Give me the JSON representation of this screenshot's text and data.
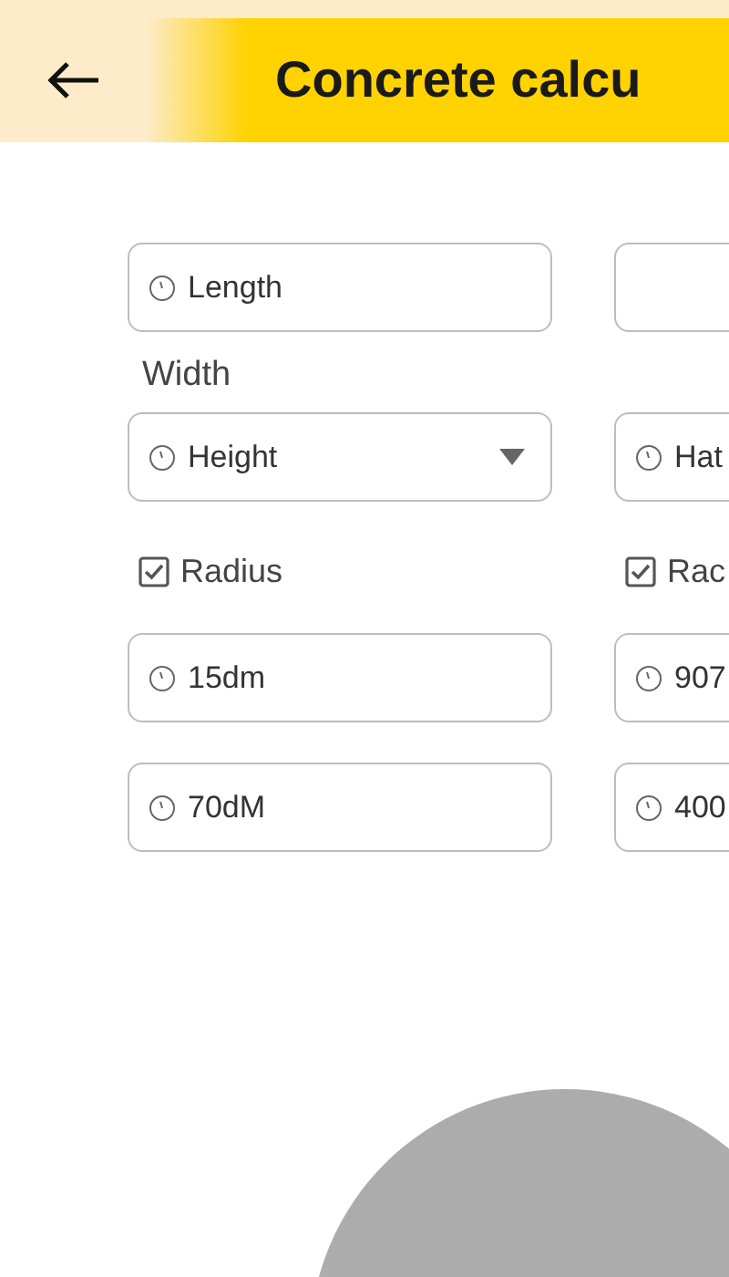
{
  "header": {
    "title": "Concrete calcu"
  },
  "rows": [
    {
      "kind": "fields",
      "cells": [
        {
          "kind": "field",
          "value": "Length"
        },
        {
          "kind": "field"
        }
      ]
    },
    {
      "kind": "label",
      "cells": [
        {
          "kind": "label",
          "value": "Width"
        }
      ]
    },
    {
      "kind": "fields",
      "cells": [
        {
          "kind": "dropdown",
          "value": "Height"
        },
        {
          "kind": "field",
          "value": "Hat"
        }
      ]
    },
    {
      "kind": "checks",
      "cells": [
        {
          "kind": "checkbox",
          "label": "Radius",
          "checked": true
        },
        {
          "kind": "checkbox",
          "label": "Rac",
          "checked": true
        }
      ]
    },
    {
      "kind": "fields",
      "cells": [
        {
          "kind": "field",
          "value": "15dm"
        },
        {
          "kind": "field",
          "value": "907"
        }
      ]
    },
    {
      "kind": "fields",
      "cells": [
        {
          "kind": "field",
          "value": "70dM"
        },
        {
          "kind": "field",
          "value": "400"
        }
      ]
    }
  ]
}
